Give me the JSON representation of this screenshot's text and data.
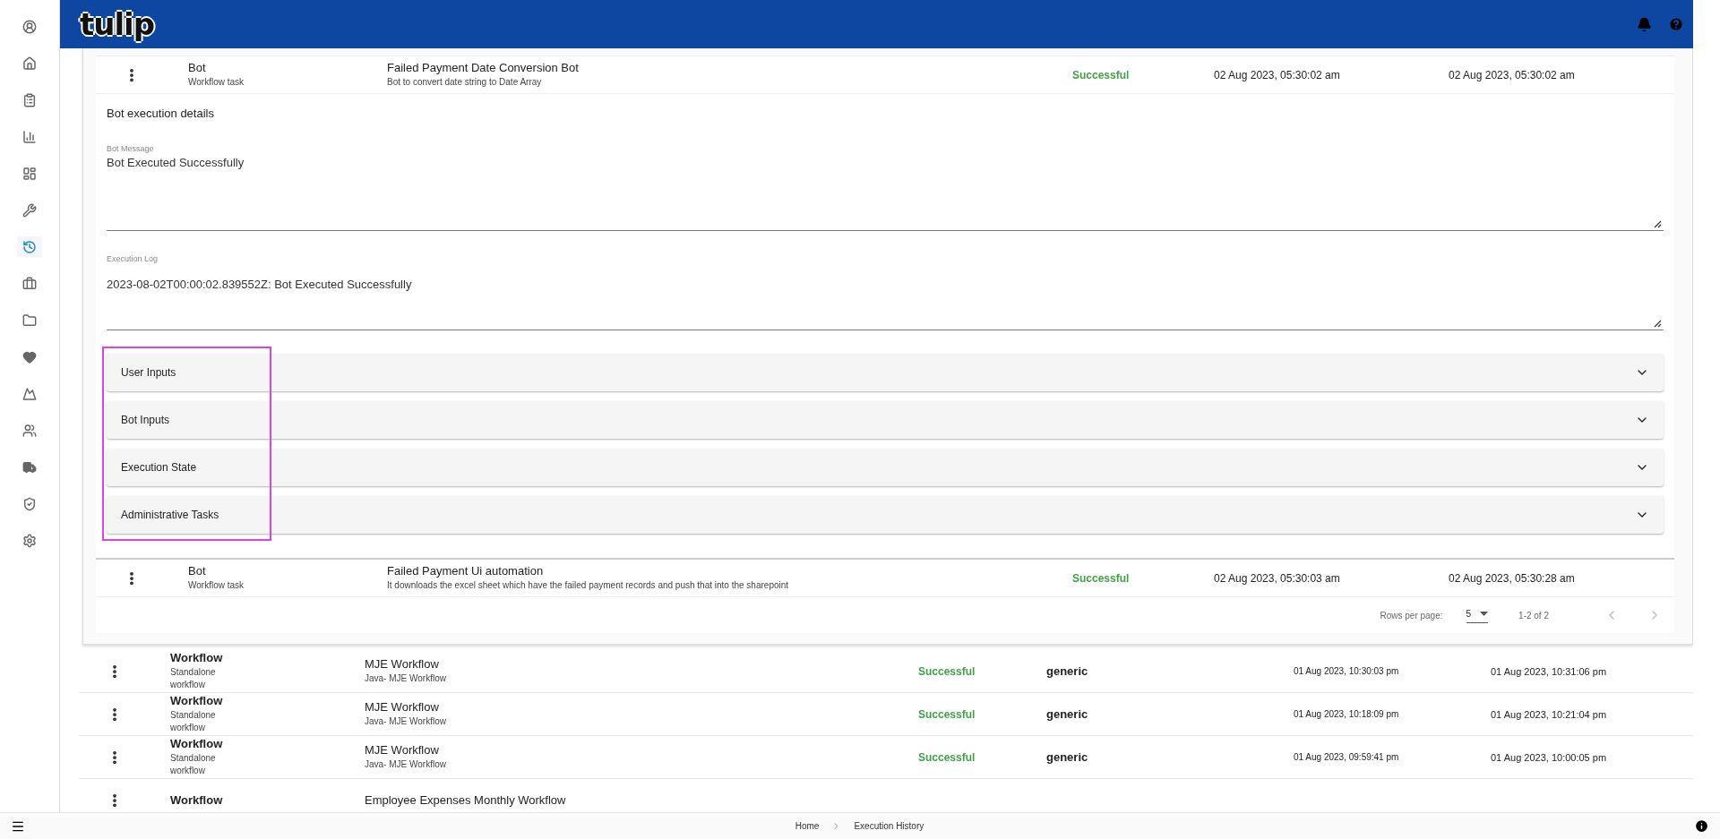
{
  "logo": "tulip",
  "sidebar": {
    "items": [
      {
        "selected": false
      },
      {
        "selected": false
      },
      {
        "selected": false
      },
      {
        "selected": false
      },
      {
        "selected": false
      },
      {
        "selected": false
      },
      {
        "selected": true
      },
      {
        "selected": false
      },
      {
        "selected": false
      },
      {
        "selected": false
      },
      {
        "selected": false
      },
      {
        "selected": false
      },
      {
        "selected": false
      },
      {
        "selected": false
      },
      {
        "selected": false
      }
    ]
  },
  "expanded_task": {
    "type": "Bot",
    "subtitle": "Workflow task",
    "name": "Failed Payment Date Conversion Bot",
    "description": "Bot to convert date string to Date Array",
    "status": "Successful",
    "start": "02 Aug 2023, 05:30:02 am",
    "end": "02 Aug 2023, 05:30:02 am"
  },
  "details": {
    "title": "Bot execution details",
    "fields": [
      {
        "label": "Bot Message",
        "value": "Bot Executed Successfully"
      },
      {
        "label": "Execution Log",
        "value": "2023-08-02T00:00:02.839552Z: Bot Executed Successfully"
      }
    ],
    "accordions": [
      {
        "title": "User Inputs",
        "expanded": false
      },
      {
        "title": "Bot Inputs",
        "expanded": false
      },
      {
        "title": "Execution State",
        "expanded": false
      },
      {
        "title": "Administrative Tasks",
        "expanded": false
      }
    ]
  },
  "task_rows": [
    {
      "type": "Bot",
      "subtitle": "Workflow task",
      "name": "Failed Payment Ui automation",
      "description": "It downloads the excel sheet which have the failed payment records and push that into the sharepoint",
      "status": "Successful",
      "start": "02 Aug 2023, 05:30:03 am",
      "end": "02 Aug 2023, 05:30:28 am"
    }
  ],
  "pagination": {
    "rows_per_page_label": "Rows per page:",
    "rows_per_page": "5",
    "range": "1-2 of 2"
  },
  "rows": [
    {
      "type": "Workflow",
      "subtitle": "Standalone workflow",
      "name": "MJE Workflow",
      "description": "Java- MJE Workflow",
      "status": "Successful",
      "user": "generic",
      "start": "01 Aug 2023, 10:30:03 pm",
      "end": "01 Aug 2023, 10:31:06 pm"
    },
    {
      "type": "Workflow",
      "subtitle": "Standalone workflow",
      "name": "MJE Workflow",
      "description": "Java- MJE Workflow",
      "status": "Successful",
      "user": "generic",
      "start": "01 Aug 2023, 10:18:09 pm",
      "end": "01 Aug 2023, 10:21:04 pm"
    },
    {
      "type": "Workflow",
      "subtitle": "Standalone workflow",
      "name": "MJE Workflow",
      "description": "Java- MJE Workflow",
      "status": "Successful",
      "user": "generic",
      "start": "01 Aug 2023, 09:59:41 pm",
      "end": "01 Aug 2023, 10:00:05 pm"
    },
    {
      "type": "Workflow",
      "name": "Employee Expenses Monthly Workflow"
    }
  ],
  "breadcrumb": [
    "Home",
    "Execution History"
  ]
}
